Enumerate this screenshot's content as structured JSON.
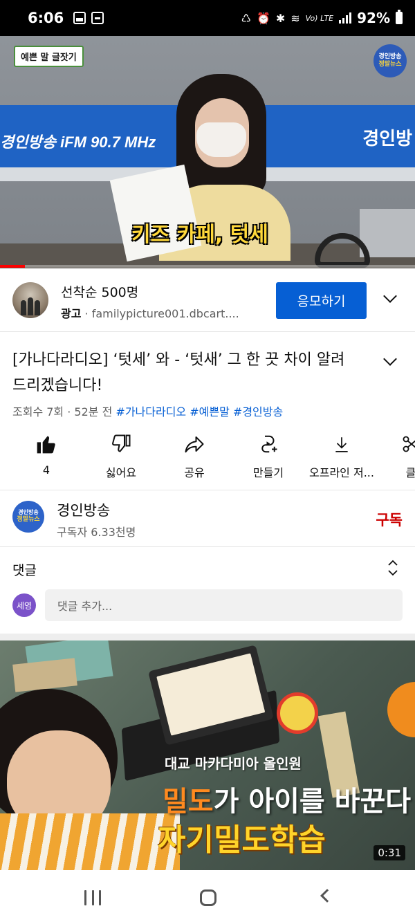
{
  "status_bar": {
    "time": "6:06",
    "network_label": "Vo) LTE",
    "battery_percent": "92%"
  },
  "video": {
    "badge_left": "예쁜 말 글잣기",
    "badge_right_line1": "경인방송",
    "badge_right_line2": "정말뉴스",
    "caption": "키즈 카페, 텃세",
    "backdrop_left_text": "경인방송 iFM 90.7 MHz",
    "backdrop_right_text": "경인방",
    "progress": 0.06
  },
  "ad": {
    "title": "선착순 500명",
    "label": "광고",
    "url": "familypicture001.dbcart....",
    "cta_label": "응모하기"
  },
  "video_info": {
    "title": "[가나다라디오] ‘텃세’ 와 - ‘텃새’  그 한 끗 차이 알려드리겠습니다!",
    "views": "조회수 7회",
    "time_ago": "52분 전",
    "hashtags": [
      "#가나다라디오",
      "#예쁜말",
      "#경인방송"
    ]
  },
  "actions": [
    {
      "icon": "thumbs-up-icon",
      "label": "4"
    },
    {
      "icon": "thumbs-down-icon",
      "label": "싫어요"
    },
    {
      "icon": "share-icon",
      "label": "공유"
    },
    {
      "icon": "remix-icon",
      "label": "만들기"
    },
    {
      "icon": "download-icon",
      "label": "오프라인 저..."
    },
    {
      "icon": "clip-icon",
      "label": "클"
    }
  ],
  "channel": {
    "name": "경인방송",
    "subscribers": "구독자 6.33천명",
    "subscribe_label": "구독",
    "avatar_line1": "경인방송",
    "avatar_line2": "정말뉴스"
  },
  "comments": {
    "title": "댓글",
    "user_avatar": "세영",
    "placeholder": "댓글 추가..."
  },
  "recommended": {
    "subtitle": "대교 마카다미아 올인원",
    "line1_highlight": "밀도",
    "line1_rest": "가 아이를 바꾼다",
    "line2": "자기밀도학습",
    "duration": "0:31"
  },
  "colors": {
    "primary_blue": "#065fd4",
    "subscribe_red": "#cc0000",
    "progress_red": "#ff0000"
  }
}
